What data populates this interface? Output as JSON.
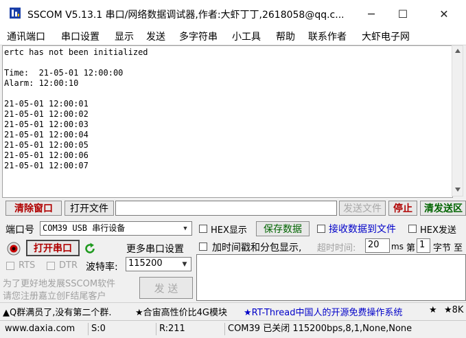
{
  "window": {
    "title": "SSCOM V5.13.1 串口/网络数据调试器,作者:大虾丁丁,2618058@qq.c...",
    "minimize_glyph": "─",
    "maximize_glyph": "☐",
    "close_glyph": "✕"
  },
  "menu": [
    "通讯端口",
    "串口设置",
    "显示",
    "发送",
    "多字符串",
    "小工具",
    "帮助",
    "联系作者",
    "大虾电子网"
  ],
  "receive_lines": [
    "ertc has not been initialized",
    "",
    "Time:  21-05-01 12:00:00",
    "Alarm: 12:00:10",
    "",
    "21-05-01 12:00:01",
    "21-05-01 12:00:02",
    "21-05-01 12:00:03",
    "21-05-01 12:00:04",
    "21-05-01 12:00:05",
    "21-05-01 12:00:06",
    "21-05-01 12:00:07"
  ],
  "toolbar": {
    "clear_window": "清除窗口",
    "open_file": "打开文件",
    "send_file": "发送文件",
    "stop": "停止",
    "clear_send": "清发送区"
  },
  "port": {
    "label": "端口号",
    "value": "COM39 USB 串行设备",
    "open_button": "打开串口",
    "more_settings": "更多串口设置",
    "rts_label": "RTS",
    "dtr_label": "DTR",
    "baud_label": "波特率:",
    "baud_value": "115200"
  },
  "options": {
    "hex_display": "HEX显示",
    "save_data": "保存数据",
    "recv_to_file": "接收数据到文件",
    "hex_send": "HEX发送",
    "timestamp": "加时间戳和分包显示,",
    "timeout_label": "超时时间:",
    "timeout_value": "20",
    "timeout_unit": "ms",
    "nth_label": "第",
    "nth_value": "1",
    "byte_label": "字节 至"
  },
  "promo": {
    "line1": "为了更好地发展SSCOM软件",
    "line2": "请您注册嘉立创F结尾客户",
    "send_button": "发 送"
  },
  "ticker": {
    "item1": "▲Q群满员了,没有第二个群.",
    "item2": "★合宙高性价比4G模块",
    "item3": "★RT-Thread中国人的开源免费操作系统",
    "item4": "★",
    "item5": "★8K"
  },
  "status": {
    "site": "www.daxia.com",
    "sent": "S:0",
    "received": "R:211",
    "port_state": "COM39 已关闭  115200bps,8,1,None,None"
  },
  "colors": {
    "accent_red": "#b00000",
    "accent_blue": "#0000c8",
    "accent_green": "#006400"
  }
}
